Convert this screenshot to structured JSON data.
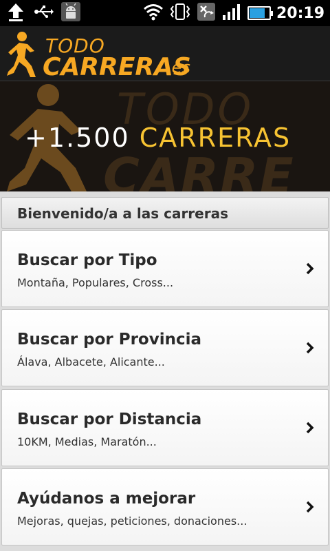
{
  "status_bar": {
    "time": "20:19",
    "icons": [
      "upload-icon",
      "usb-icon",
      "android-debug-icon",
      "wifi-icon",
      "vibrate-icon",
      "no-sync-icon",
      "signal-icon",
      "battery-charging-icon"
    ]
  },
  "header": {
    "logo_top": "TODO",
    "logo_main": "CARRERAS",
    "logo_tld": ".es"
  },
  "banner": {
    "number": "+1.500",
    "word": "CARRERAS",
    "bg_line1": "TODO",
    "bg_line2": "CARRE"
  },
  "section": {
    "title": "Bienvenido/a a las carreras"
  },
  "menu": [
    {
      "title": "Buscar por Tipo",
      "subtitle": "Montaña, Populares, Cross..."
    },
    {
      "title": "Buscar por Provincia",
      "subtitle": "Álava, Albacete, Alicante..."
    },
    {
      "title": "Buscar por Distancia",
      "subtitle": "10KM, Medias, Maratón..."
    },
    {
      "title": "Ayúdanos a mejorar",
      "subtitle": "Mejoras, quejas, peticiones, donaciones..."
    }
  ],
  "colors": {
    "brand_orange": "#f7a823",
    "banner_yellow": "#f7c332",
    "header_bg": "#1b1b1b",
    "battery_blue": "#2aa0e0"
  }
}
